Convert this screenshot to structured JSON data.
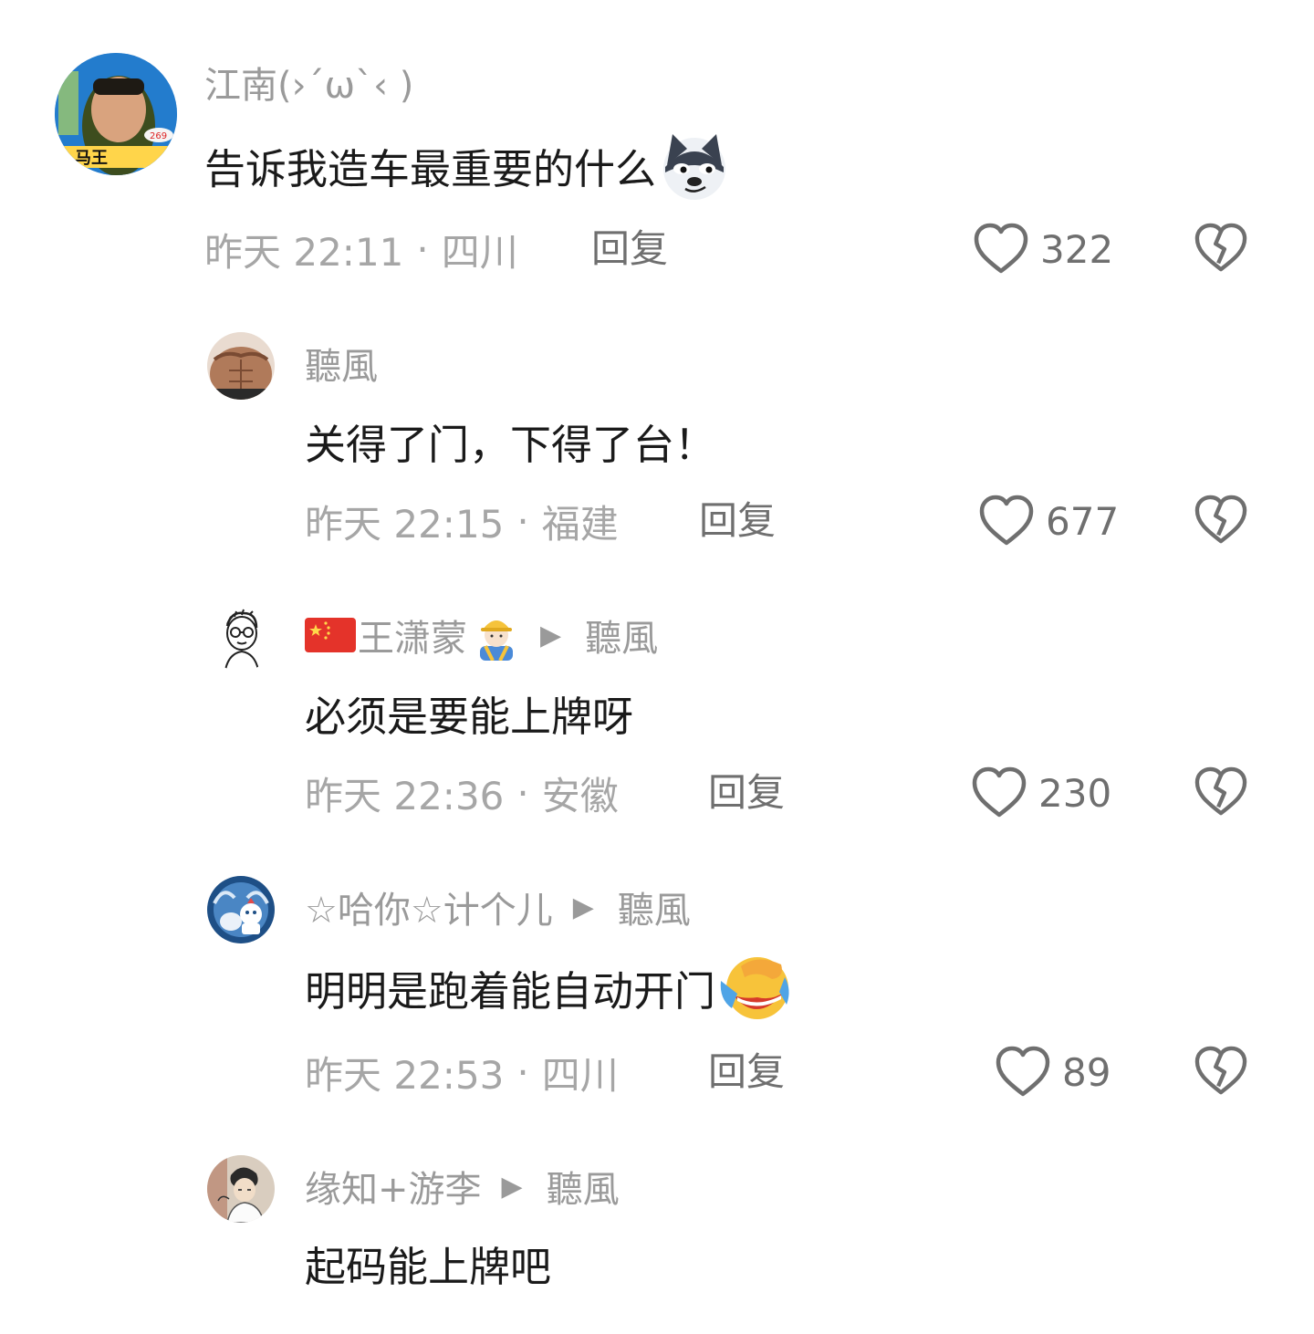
{
  "comments": [
    {
      "name": "江南(›´ω`‹ )",
      "text": "告诉我造车最重要的什么",
      "emoji": "husky-smirk-emoji",
      "time": "昨天 22:11",
      "location": "四川",
      "reply_label": "回复",
      "likes": "322",
      "avatar": "photo-avatar-man-blue-bg"
    },
    {
      "name": "聽風",
      "text": "关得了门，下得了台！",
      "time": "昨天 22:15",
      "location": "福建",
      "reply_label": "回复",
      "likes": "677",
      "avatar": "photo-avatar-torso"
    },
    {
      "name": "王潇蒙",
      "name_prefix_icon": "china-flag-emoji",
      "name_suffix_icon": "construction-worker-emoji",
      "reply_to": "聽風",
      "text": "必须是要能上牌呀",
      "time": "昨天 22:36",
      "location": "安徽",
      "reply_label": "回复",
      "likes": "230",
      "avatar": "sketch-avatar-glasses"
    },
    {
      "name": "☆哈你☆计个儿",
      "reply_to": "聽風",
      "text": "明明是跑着能自动开门",
      "emoji": "face-palm-laugh-emoji",
      "time": "昨天 22:53",
      "location": "四川",
      "reply_label": "回复",
      "likes": "89",
      "avatar": "cartoon-avatar-blue"
    },
    {
      "name": "缘知+游李",
      "reply_to": "聽風",
      "text": "起码能上牌吧",
      "time": "",
      "location": "",
      "reply_label": "",
      "likes": "",
      "avatar": "illustrated-avatar-person"
    }
  ],
  "separator": "·",
  "colors": {
    "name": "#9a9a9a",
    "text": "#1a1a1a",
    "meta": "#a6a6a6",
    "action": "#6f6f6f",
    "background": "#ffffff"
  },
  "icons": {
    "like": "heart-outline-icon",
    "dislike": "broken-heart-icon",
    "reply_arrow": "play-triangle-icon"
  }
}
